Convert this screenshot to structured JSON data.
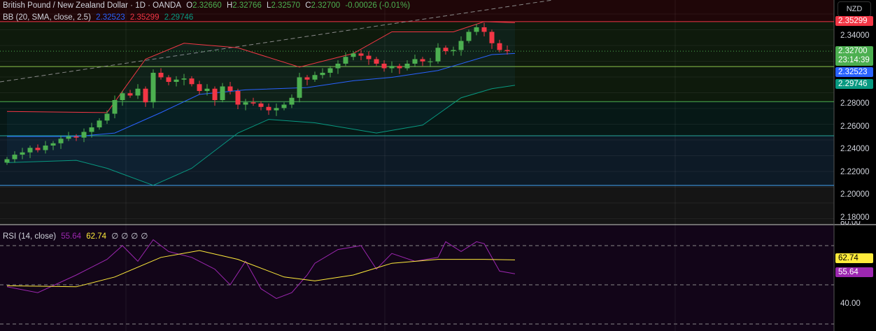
{
  "header": {
    "symbol": "British Pound / New Zealand Dollar · 1D · OANDA",
    "o_label": "O",
    "o": "2.32660",
    "h_label": "H",
    "h": "2.32766",
    "l_label": "L",
    "l": "2.32570",
    "c_label": "C",
    "c": "2.32700",
    "change": "-0.00026 (-0.01%)"
  },
  "bb": {
    "label": "BB (20, SMA, close, 2.5)",
    "basis": "2.32523",
    "upper": "2.35299",
    "lower": "2.29746"
  },
  "rsi": {
    "label": "RSI (14, close)",
    "value": "55.64",
    "ma": "62.74",
    "extras": [
      "∅",
      "∅",
      "∅",
      "∅"
    ]
  },
  "currency": "NZD",
  "price_axis": [
    "2.34000",
    "2.28000",
    "2.26000",
    "2.24000",
    "2.22000",
    "2.20000",
    "2.18000"
  ],
  "tags": {
    "upper": "2.35299",
    "last": "2.32700",
    "countdown": "23:14:39",
    "basis": "2.32523",
    "lower": "2.29746",
    "rsi_ma": "62.74",
    "rsi": "55.64"
  },
  "rsi_axis": [
    "80.00",
    "40.00"
  ],
  "colors": {
    "up": "#4caf50",
    "down": "#f23645",
    "basis": "#2962ff",
    "upper": "#f23645",
    "lower": "#089981",
    "rsi": "#9c27b0",
    "rsi_ma": "#ffeb3b"
  },
  "chart_data": {
    "type": "candlestick",
    "ylim": [
      2.17,
      2.36
    ],
    "closes": [
      2.232,
      2.236,
      2.238,
      2.242,
      2.24,
      2.244,
      2.246,
      2.25,
      2.252,
      2.251,
      2.256,
      2.26,
      2.266,
      2.272,
      2.284,
      2.29,
      2.288,
      2.294,
      2.282,
      2.308,
      2.304,
      2.3,
      2.302,
      2.303,
      2.298,
      2.292,
      2.294,
      2.284,
      2.296,
      2.292,
      2.28,
      2.282,
      2.281,
      2.278,
      2.275,
      2.277,
      2.28,
      2.286,
      2.304,
      2.302,
      2.306,
      2.308,
      2.312,
      2.316,
      2.322,
      2.325,
      2.323,
      2.32,
      2.316,
      2.312,
      2.314,
      2.312,
      2.316,
      2.32,
      2.318,
      2.318,
      2.33,
      2.327,
      2.328,
      2.336,
      2.344,
      2.348,
      2.344,
      2.334,
      2.328,
      2.327
    ],
    "bb_upper": [
      [
        0,
        2.274
      ],
      [
        13,
        2.273
      ],
      [
        18,
        2.32
      ],
      [
        23,
        2.334
      ],
      [
        30,
        2.33
      ],
      [
        38,
        2.313
      ],
      [
        45,
        2.325
      ],
      [
        50,
        2.344
      ],
      [
        58,
        2.344
      ],
      [
        62,
        2.353
      ],
      [
        66,
        2.352
      ]
    ],
    "bb_basis": [
      [
        0,
        2.252
      ],
      [
        9,
        2.252
      ],
      [
        14,
        2.255
      ],
      [
        20,
        2.273
      ],
      [
        25,
        2.289
      ],
      [
        31,
        2.293
      ],
      [
        39,
        2.295
      ],
      [
        45,
        2.301
      ],
      [
        50,
        2.304
      ],
      [
        56,
        2.31
      ],
      [
        63,
        2.324
      ],
      [
        66,
        2.325
      ]
    ],
    "bb_lower": [
      [
        0,
        2.229
      ],
      [
        9,
        2.231
      ],
      [
        13,
        2.224
      ],
      [
        19,
        2.209
      ],
      [
        24,
        2.224
      ],
      [
        30,
        2.255
      ],
      [
        34,
        2.267
      ],
      [
        40,
        2.264
      ],
      [
        48,
        2.255
      ],
      [
        54,
        2.262
      ],
      [
        59,
        2.286
      ],
      [
        63,
        2.294
      ],
      [
        66,
        2.297
      ]
    ],
    "levels": [
      2.35299,
      2.3135,
      2.2826,
      2.2526,
      2.2089
    ],
    "rsi_ylim": [
      28,
      80
    ],
    "rsi": [
      [
        0,
        49
      ],
      [
        4,
        46
      ],
      [
        9,
        55
      ],
      [
        13,
        63
      ],
      [
        15,
        70
      ],
      [
        17,
        62
      ],
      [
        19,
        73
      ],
      [
        21,
        67
      ],
      [
        24,
        64
      ],
      [
        27,
        58
      ],
      [
        29,
        50
      ],
      [
        31,
        62
      ],
      [
        33,
        48
      ],
      [
        35,
        43
      ],
      [
        37,
        46
      ],
      [
        39,
        55
      ],
      [
        40,
        61
      ],
      [
        43,
        68
      ],
      [
        46,
        70
      ],
      [
        48,
        58
      ],
      [
        50,
        66
      ],
      [
        53,
        62
      ],
      [
        56,
        64
      ],
      [
        57,
        72
      ],
      [
        59,
        67
      ],
      [
        61,
        72
      ],
      [
        62,
        71
      ],
      [
        64,
        57
      ],
      [
        66,
        55.64
      ]
    ],
    "rsi_ma": [
      [
        0,
        49.5
      ],
      [
        9,
        49
      ],
      [
        14,
        54
      ],
      [
        20,
        64
      ],
      [
        25,
        67.5
      ],
      [
        30,
        63
      ],
      [
        36,
        54
      ],
      [
        40,
        52
      ],
      [
        45,
        55
      ],
      [
        50,
        61
      ],
      [
        56,
        63
      ],
      [
        62,
        63
      ],
      [
        66,
        62.74
      ]
    ],
    "rsi_levels": [
      70,
      50,
      30
    ]
  }
}
